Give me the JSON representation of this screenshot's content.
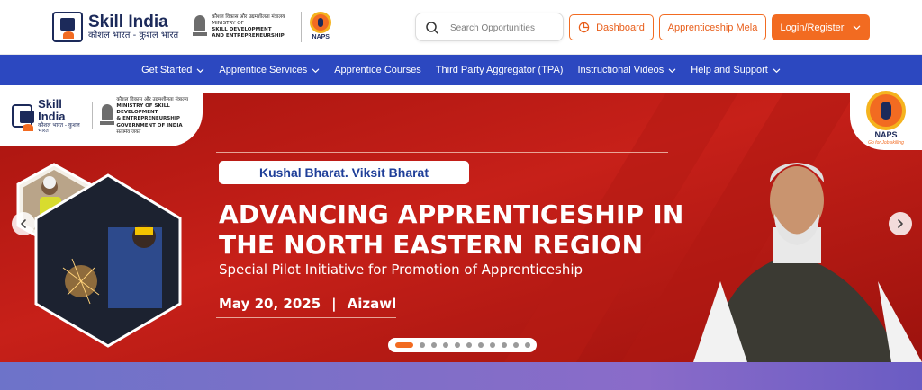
{
  "header": {
    "brand": {
      "title": "Skill India",
      "subtitle": "कौशल भारत - कुशल भारत"
    },
    "ministry": {
      "hindi": "कौशल विकास और उद्यमशीलता मंत्रालय",
      "line1": "MINISTRY OF",
      "line2": "SKILL DEVELOPMENT",
      "line3": "AND ENTREPRENEURSHIP"
    },
    "naps_label": "NAPS",
    "search": {
      "placeholder": "Search Opportunities"
    },
    "buttons": {
      "dashboard": "Dashboard",
      "mela": "Apprenticeship Mela",
      "login": "Login/Register"
    }
  },
  "nav": {
    "items": [
      {
        "label": "Get Started",
        "has_dropdown": true
      },
      {
        "label": "Apprentice Services",
        "has_dropdown": true
      },
      {
        "label": "Apprentice Courses",
        "has_dropdown": false
      },
      {
        "label": "Third Party Aggregator (TPA)",
        "has_dropdown": false
      },
      {
        "label": "Instructional Videos",
        "has_dropdown": true
      },
      {
        "label": "Help and Support",
        "has_dropdown": true
      }
    ]
  },
  "banner": {
    "brand": {
      "title": "Skill India",
      "subtitle": "कौशल भारत - कुशल भारत"
    },
    "ministry": {
      "hindi": "कौशल विकास और उद्यमशीलता मंत्रालय",
      "line1": "MINISTRY OF SKILL DEVELOPMENT",
      "line2": "& ENTREPRENEURSHIP",
      "line3": "GOVERNMENT OF INDIA",
      "emblem_caption": "सत्यमेव जयते"
    },
    "naps": {
      "name": "NAPS",
      "tagline": "Go for Job skilling"
    },
    "tag": "Kushal Bharat. Viksit Bharat",
    "headline_line1": "ADVANCING APPRENTICESHIP IN",
    "headline_line2": "THE NORTH EASTERN REGION",
    "subline": "Special Pilot Initiative for Promotion of Apprenticeship",
    "date": "May 20, 2025",
    "separator": "|",
    "location": "Aizawl",
    "slides": {
      "total": 11,
      "active": 1
    }
  },
  "colors": {
    "primary_orange": "#f26b21",
    "nav_blue": "#2c48c0",
    "brand_navy": "#1c2a5a",
    "banner_red": "#c41f1a",
    "tag_blue": "#1f3f99"
  },
  "icons": {
    "search": "search-icon",
    "dashboard": "pie-chart-icon",
    "dropdown": "chevron-down-icon",
    "prev": "chevron-left-icon",
    "next": "chevron-right-icon"
  }
}
